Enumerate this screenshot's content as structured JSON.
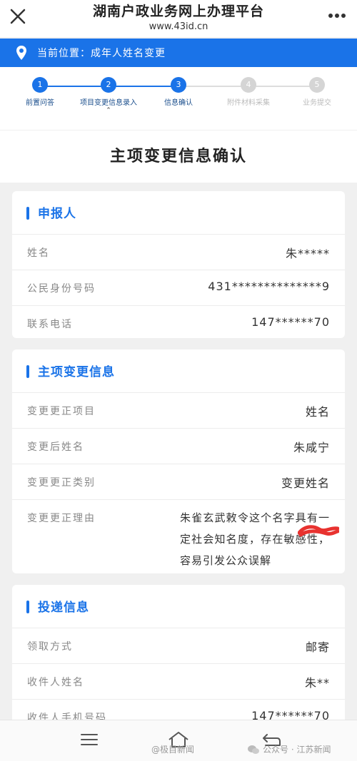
{
  "header": {
    "title": "湖南户政业务网上办理平台",
    "url": "www.43id.cn"
  },
  "location": {
    "label": "当前位置：成年人姓名变更"
  },
  "steps": [
    {
      "number": "1",
      "label": "前置问答",
      "state": "done"
    },
    {
      "number": "2",
      "label": "项目变更信息录入",
      "state": "done"
    },
    {
      "number": "3",
      "label": "信息确认",
      "state": "current"
    },
    {
      "number": "4",
      "label": "附件材料采集",
      "state": "pending"
    },
    {
      "number": "5",
      "label": "业务提交",
      "state": "pending"
    }
  ],
  "page_heading": "主项变更信息确认",
  "applicant": {
    "title": "申报人",
    "rows": [
      {
        "label": "姓名",
        "value": "朱*****"
      },
      {
        "label": "公民身份号码",
        "value": "431**************9"
      },
      {
        "label": "联系电话",
        "value": "147******70"
      }
    ]
  },
  "change_info": {
    "title": "主项变更信息",
    "rows": [
      {
        "label": "变更更正项目",
        "value": "姓名"
      },
      {
        "label": "变更后姓名",
        "value": "朱咸宁"
      },
      {
        "label": "变更更正类别",
        "value": "变更姓名"
      },
      {
        "label": "变更更正理由",
        "value": "朱雀玄武敕令这个名字具有一定社会知名度，存在敏感性，容易引发公众误解"
      }
    ]
  },
  "delivery": {
    "title": "投递信息",
    "rows": [
      {
        "label": "领取方式",
        "value": "邮寄"
      },
      {
        "label": "收件人姓名",
        "value": "朱**"
      },
      {
        "label": "收件人手机号码",
        "value": "147******70"
      }
    ]
  },
  "watermarks": {
    "left": "@极目新闻",
    "right": "公众号 · 江苏新闻"
  },
  "colors": {
    "primary": "#1a73e8",
    "redact": "#e8322f"
  }
}
